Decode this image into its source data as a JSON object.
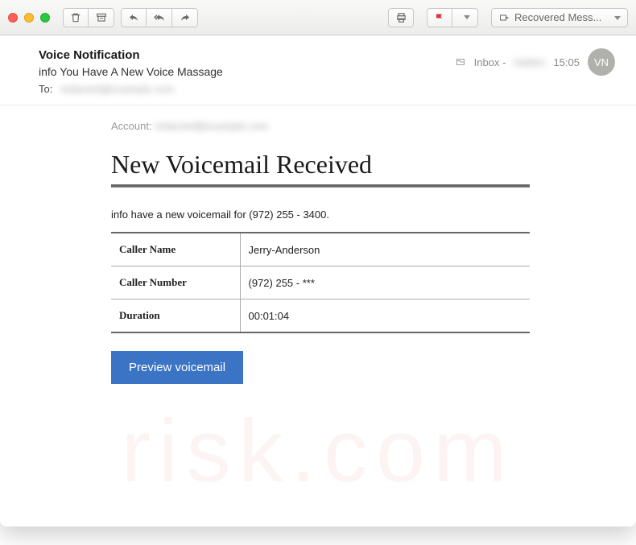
{
  "toolbar": {
    "recovered_label": "Recovered Mess..."
  },
  "header": {
    "from": "Voice Notification",
    "subject": "info You Have A New Voice Massage",
    "to_label": "To:",
    "to_value": "redacted@example.com",
    "mailbox_label": "Inbox -",
    "time": "15:05",
    "avatar_initials": "VN"
  },
  "body": {
    "account_label": "Account:",
    "account_value": "redacted@example.com",
    "title": "New Voicemail Received",
    "info_line": "info have a new voicemail for (972) 255 - 3400.",
    "rows": [
      {
        "k": "Caller Name",
        "v": "Jerry-Anderson"
      },
      {
        "k": "Caller Number",
        "v": "(972) 255 - ***"
      },
      {
        "k": "Duration",
        "v": "00:01:04"
      }
    ],
    "cta_label": "Preview voicemail"
  },
  "watermark": "risk.com"
}
